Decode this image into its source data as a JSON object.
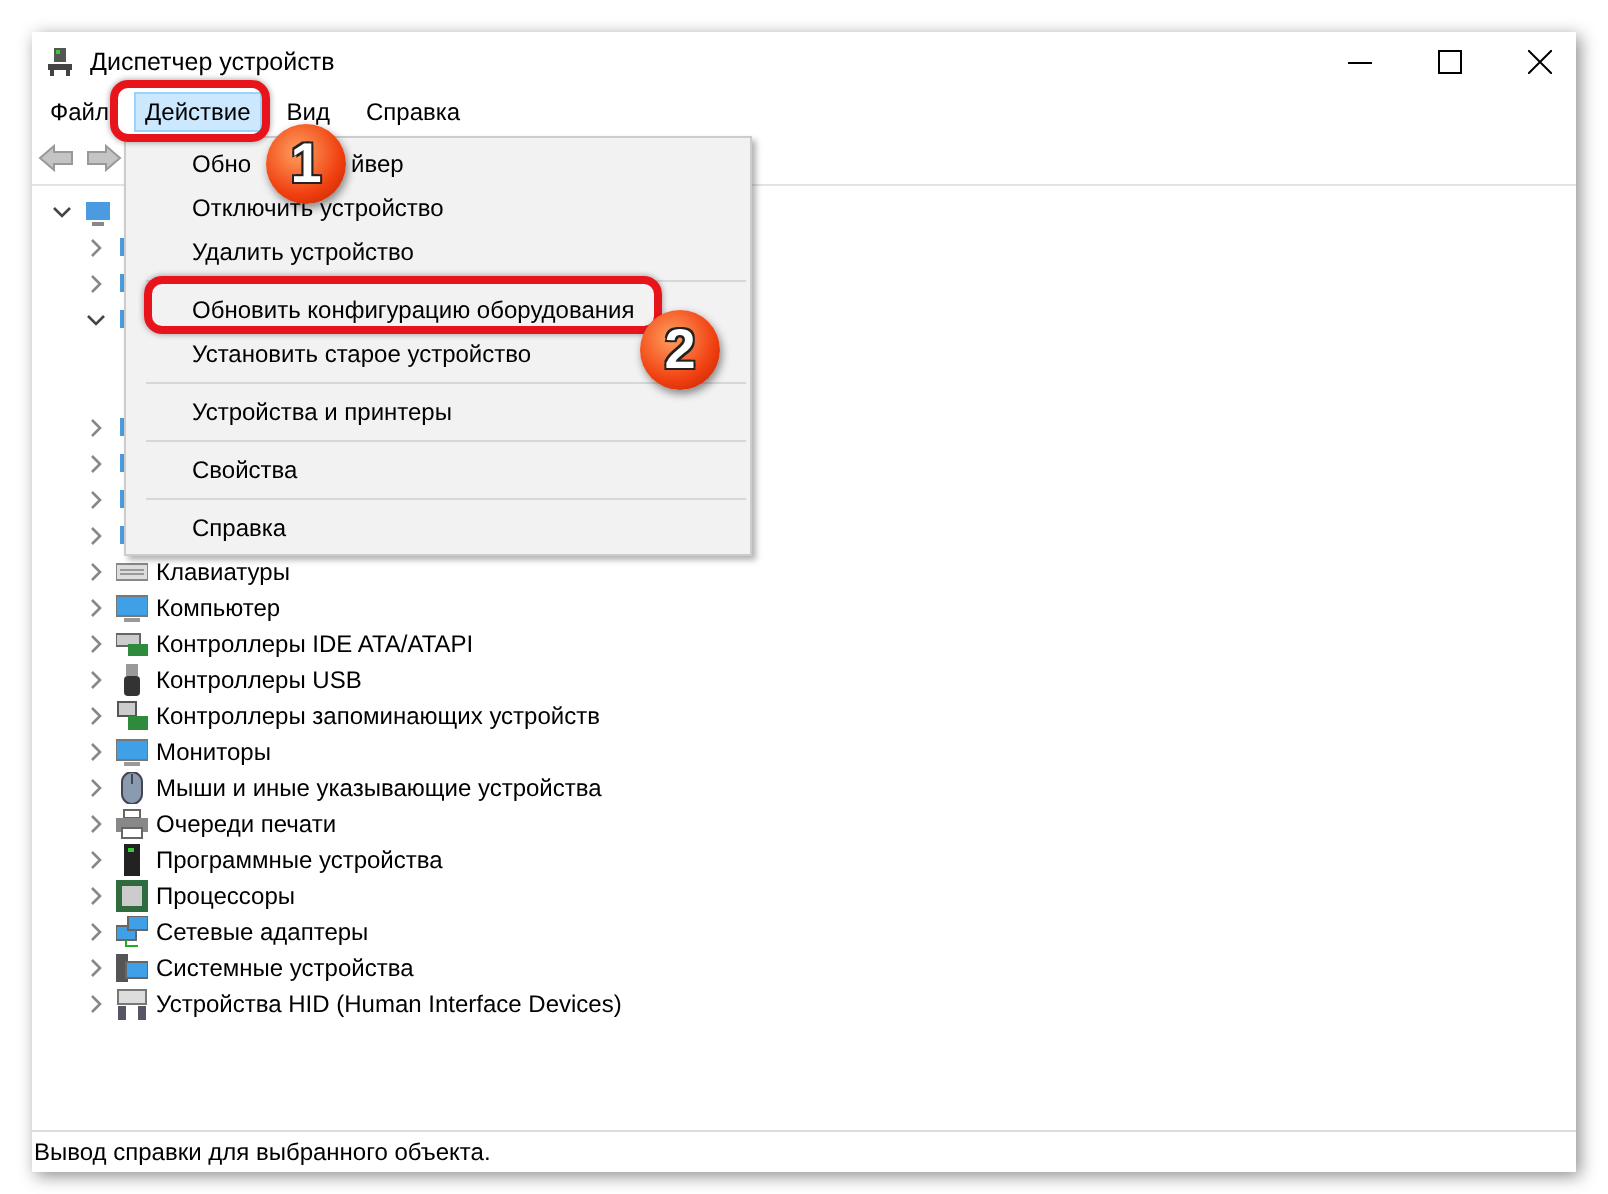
{
  "window": {
    "title": "Диспетчер устройств"
  },
  "menu_bar": [
    {
      "label": "Файл",
      "selected": false
    },
    {
      "label": "Действие",
      "selected": true
    },
    {
      "label": "Вид",
      "selected": false
    },
    {
      "label": "Справка",
      "selected": false
    }
  ],
  "tree": {
    "expanded": true,
    "children": [
      {
        "expanded": false
      },
      {
        "expanded": false
      },
      {
        "expanded": true,
        "children": [
          {
            "kind": "device"
          },
          {
            "kind": "device"
          }
        ]
      },
      {
        "expanded": false
      },
      {
        "expanded": false
      },
      {
        "expanded": false
      },
      {
        "expanded": false
      },
      {
        "label": "Клавиатуры",
        "expanded": false
      },
      {
        "label": "Компьютер",
        "expanded": false
      },
      {
        "label": "Контроллеры IDE ATA/ATAPI",
        "expanded": false
      },
      {
        "label": "Контроллеры USB",
        "expanded": false
      },
      {
        "label": "Контроллеры запоминающих устройств",
        "expanded": false
      },
      {
        "label": "Мониторы",
        "expanded": false
      },
      {
        "label": "Мыши и иные указывающие устройства",
        "expanded": false
      },
      {
        "label": "Очереди печати",
        "expanded": false
      },
      {
        "label": "Программные устройства",
        "expanded": false
      },
      {
        "label": "Процессоры",
        "expanded": false
      },
      {
        "label": "Сетевые адаптеры",
        "expanded": false
      },
      {
        "label": "Системные устройства",
        "expanded": false
      },
      {
        "label": "Устройства HID (Human Interface Devices)",
        "expanded": false
      }
    ]
  },
  "dropdown_menu": [
    {
      "kind": "split",
      "parts": [
        "Обно",
        "йвер"
      ]
    },
    {
      "kind": "item",
      "label": "Отключить устройство"
    },
    {
      "kind": "item",
      "label": "Удалить устройство"
    },
    {
      "kind": "separator"
    },
    {
      "kind": "item",
      "label": "Обновить конфигурацию оборудования"
    },
    {
      "kind": "item",
      "label": "Установить старое устройство"
    },
    {
      "kind": "separator"
    },
    {
      "kind": "item",
      "label": "Устройства и принтеры"
    },
    {
      "kind": "separator"
    },
    {
      "kind": "item",
      "label": "Свойства"
    },
    {
      "kind": "separator"
    },
    {
      "kind": "item",
      "label": "Справка"
    }
  ],
  "annotations": [
    {
      "number": "1"
    },
    {
      "number": "2"
    }
  ],
  "status_bar": "Вывод справки для выбранного объекта."
}
